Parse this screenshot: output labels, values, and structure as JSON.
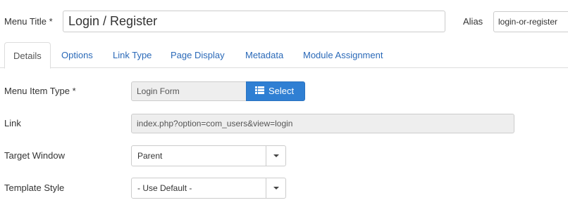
{
  "header": {
    "menu_title_label": "Menu Title *",
    "menu_title_value": "Login / Register",
    "alias_label": "Alias",
    "alias_value": "login-or-register"
  },
  "tabs": [
    {
      "label": "Details",
      "active": true
    },
    {
      "label": "Options",
      "active": false
    },
    {
      "label": "Link Type",
      "active": false
    },
    {
      "label": "Page Display",
      "active": false
    },
    {
      "label": "Metadata",
      "active": false
    },
    {
      "label": "Module Assignment",
      "active": false
    }
  ],
  "form": {
    "menu_item_type_label": "Menu Item Type *",
    "menu_item_type_value": "Login Form",
    "select_button_label": "Select",
    "link_label": "Link",
    "link_value": "index.php?option=com_users&view=login",
    "target_window_label": "Target Window",
    "target_window_value": "Parent",
    "template_style_label": "Template Style",
    "template_style_value": "- Use Default -"
  },
  "colors": {
    "accent": "#2f7fd3",
    "link": "#2a69b8"
  },
  "icons": {
    "select_button_icon": "list-icon",
    "dropdown_icon": "caret-down-icon"
  }
}
